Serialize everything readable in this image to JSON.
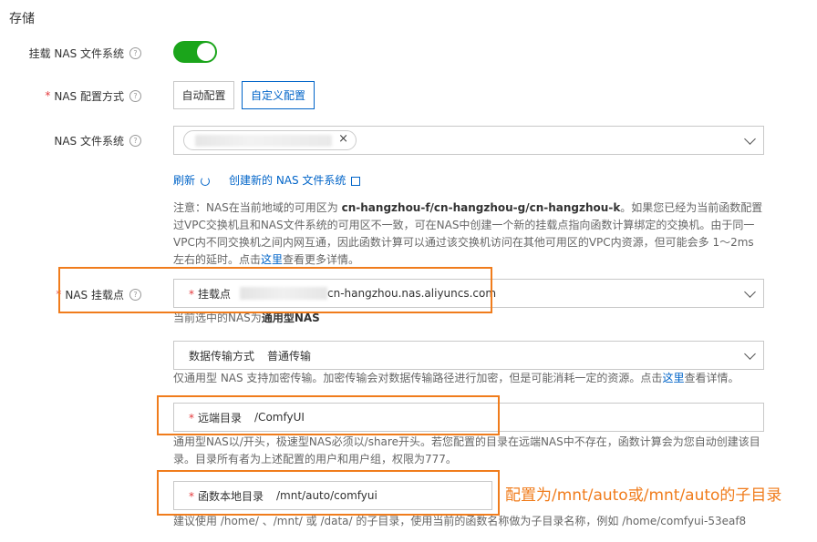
{
  "section_title": "存储",
  "mount_nas": {
    "label": "挂载 NAS 文件系统",
    "enabled": true
  },
  "nas_config": {
    "label": "NAS 配置方式",
    "options": [
      "自动配置",
      "自定义配置"
    ],
    "selected": "自定义配置"
  },
  "nas_fs": {
    "label": "NAS 文件系统",
    "refresh": "刷新",
    "create_new": "创建新的 NAS 文件系统"
  },
  "notice": {
    "prefix": "注意：NAS在当前地域的可用区为 ",
    "zones": "cn-hangzhou-f/cn-hangzhou-g/cn-hangzhou-k",
    "body": "。如果您已经为当前函数配置过VPC交换机且和NAS文件系统的可用区不一致，可在NAS中创建一个新的挂载点指向函数计算绑定的交换机。由于同一VPC内不同交换机之间内网互通，因此函数计算可以通过该交换机访问在其他可用区的VPC内资源，但可能会多 1～2ms 左右的延时。点击",
    "link": "这里",
    "suffix": "查看更多详情。"
  },
  "mount_point": {
    "label": "NAS 挂载点",
    "field_label": "挂载点",
    "value_suffix": "cn-hangzhou.nas.aliyuncs.com",
    "type_prefix": "当前选中的NAS为",
    "type_value": "通用型NAS"
  },
  "transfer": {
    "field_label": "数据传输方式",
    "value": "普通传输",
    "note_prefix": "仅通用型 NAS 支持加密传输。加密传输会对数据传输路径进行加密，但是可能消耗一定的资源。点击",
    "note_link": "这里",
    "note_suffix": "查看详情。"
  },
  "remote_dir": {
    "field_label": "远端目录",
    "value": "/ComfyUI",
    "note": "通用型NAS以/开头，极速型NAS必须以/share开头。若您配置的目录在远端NAS中不存在，函数计算会为您自动创建该目录。目录所有者为上述配置的用户和用户组，权限为777。"
  },
  "local_dir": {
    "field_label": "函数本地目录",
    "value": "/mnt/auto/comfyui",
    "annotation": "配置为/mnt/auto或/mnt/auto的子目录",
    "note": "建议使用 /home/ 、/mnt/ 或 /data/ 的子目录，使用当前的函数名称做为子目录名称，例如 /home/comfyui-53eaf8"
  },
  "colors": {
    "accent": "#0064c8",
    "toggle_on": "#1ba51b",
    "highlight": "#f07c1c",
    "required": "#e4393c"
  }
}
